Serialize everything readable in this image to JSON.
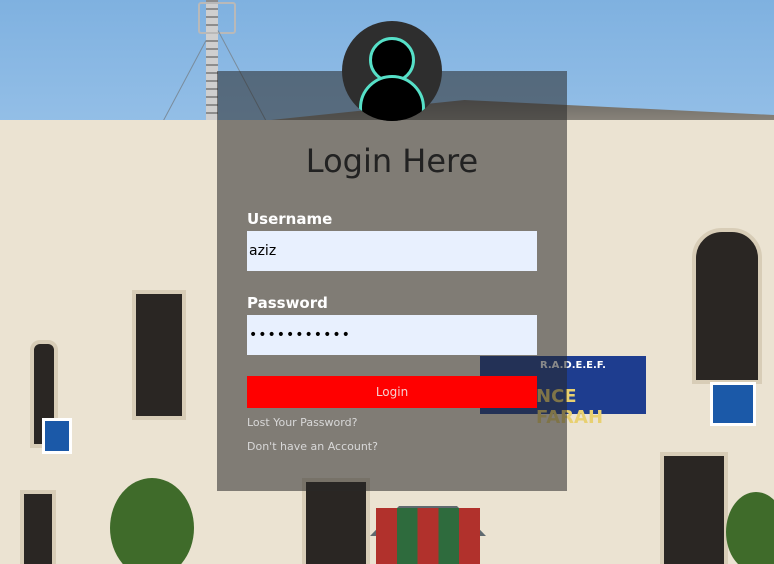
{
  "background": {
    "sign_top": "R.A.D.E.E.F.",
    "sign_main": "NCE FARAH"
  },
  "login": {
    "title": "Login Here",
    "username_label": "Username",
    "username_value": "aziz",
    "password_label": "Password",
    "password_value": "•••••••••••",
    "submit_label": "Login",
    "lost_password_link": "Lost Your Password?",
    "signup_link": "Don't have an Account?",
    "avatar_icon": "user-icon",
    "accent_color": "#56e0c8",
    "button_color": "#ff0000"
  }
}
